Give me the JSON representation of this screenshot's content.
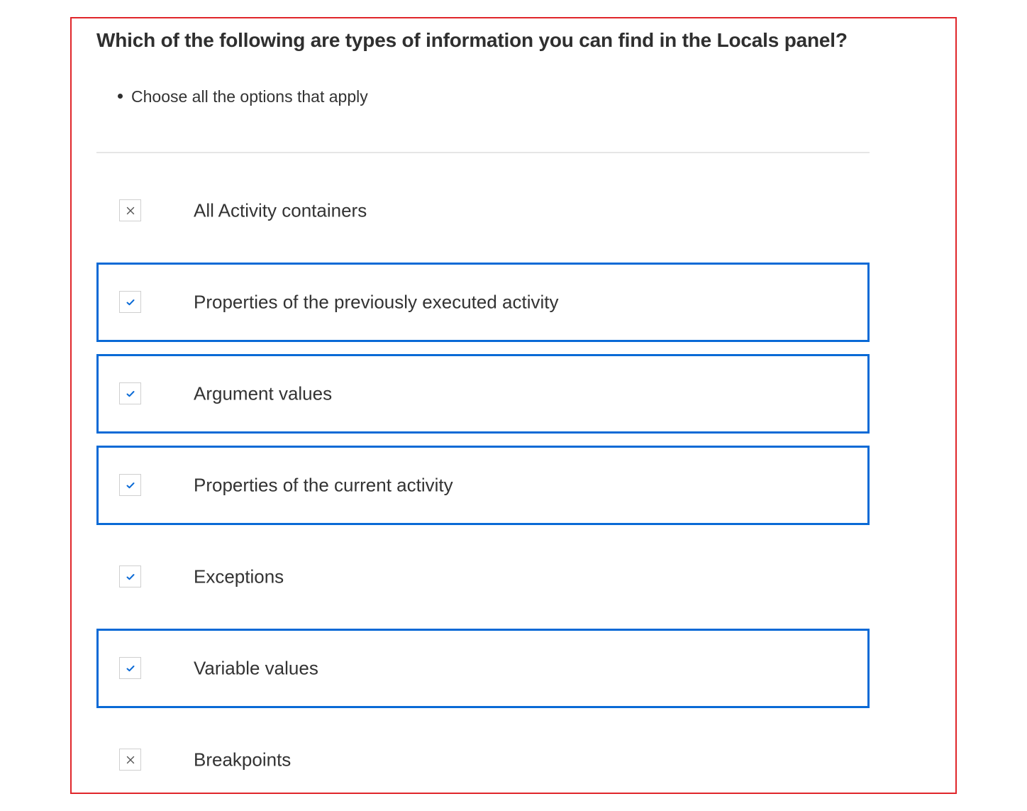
{
  "question": {
    "title": "Which of the following are types of information you can find in the Locals panel?",
    "hint": "Choose all the options that apply"
  },
  "colors": {
    "frame_border": "#e0262b",
    "selected_border": "#0a6ad6",
    "check_color": "#0a6ad6",
    "cross_color": "#555555"
  },
  "options": [
    {
      "label": "All Activity containers",
      "mark": "cross-icon",
      "selected": false
    },
    {
      "label": "Properties of the previously executed activity",
      "mark": "check-icon",
      "selected": true
    },
    {
      "label": "Argument values",
      "mark": "check-icon",
      "selected": true
    },
    {
      "label": "Properties of the current activity",
      "mark": "check-icon",
      "selected": true
    },
    {
      "label": "Exceptions",
      "mark": "check-icon",
      "selected": false
    },
    {
      "label": "Variable values",
      "mark": "check-icon",
      "selected": true
    },
    {
      "label": "Breakpoints",
      "mark": "cross-icon",
      "selected": false
    }
  ]
}
